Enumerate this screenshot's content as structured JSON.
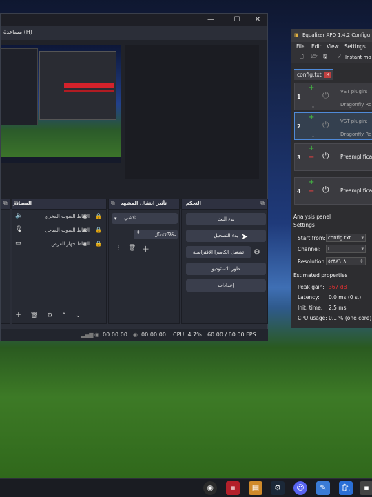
{
  "obs": {
    "help_menu": "مساعدة (H)",
    "window_controls": {
      "minimize": "—",
      "maximize": "☐",
      "close": "✕"
    },
    "sources": {
      "title": "المصادر",
      "items": [
        {
          "label": "التقاط الصوت المخرج",
          "icon": "speaker-icon"
        },
        {
          "label": "التقاط الصوت المدخل",
          "icon": "microphone-icon"
        },
        {
          "label": "التقاط جهاز العرض",
          "icon": "monitor-icon"
        }
      ]
    },
    "transitions": {
      "title": "تأثير انتقال المشهد",
      "selected": "تلاشي",
      "duration_label": "مدة الانتقال",
      "duration_value": "٣٠٠ ms"
    },
    "controls": {
      "title": "التحكم",
      "buttons": [
        "بدء البث",
        "بدء التسجيل",
        "تشغيل الكاميرا الافتراضية",
        "طور الاستوديو",
        "إعدادات"
      ]
    },
    "status": {
      "stream_time": "00:00:00",
      "rec_time": "00:00:00",
      "cpu": "CPU: 4.7%",
      "fps": "60.00 / 60.00 FPS"
    }
  },
  "eq": {
    "title": "Equalizer APO 1.4.2 Configu",
    "menu": [
      "File",
      "Edit",
      "View",
      "Settings"
    ],
    "toolbar_option": "Instant mo",
    "tab": "config.txt",
    "rows": [
      {
        "num": "1",
        "type": "vst",
        "label": "VST plugin:",
        "plugin": "Dragonfly Ro"
      },
      {
        "num": "2",
        "type": "vst",
        "label": "VST plugin:",
        "plugin": "Dragonfly Ro"
      },
      {
        "num": "3",
        "type": "pre",
        "label": "Preamplificat"
      },
      {
        "num": "4",
        "type": "pre",
        "label": "Preamplificat"
      }
    ],
    "analysis": {
      "panel_title": "Analysis panel",
      "settings_title": "Settings",
      "start_from_label": "Start from:",
      "start_from_value": "config.txt",
      "channel_label": "Channel:",
      "channel_value": "L",
      "resolution_label": "Resolution:",
      "resolution_value": "٥٢٣٨٦٠٨",
      "estimated_title": "Estimated properties",
      "peak_gain_label": "Peak gain:",
      "peak_gain_value": "367 dB",
      "peak_gain_color": "#e03030",
      "latency_label": "Latency:",
      "latency_value": "0.0 ms (0 s.)",
      "init_time_label": "Init. time:",
      "init_time_value": "2.5 ms",
      "cpu_usage_label": "CPU usage:",
      "cpu_usage_value": "0.1 % (one core)"
    }
  },
  "taskbar": {
    "icons": [
      "obs-icon",
      "game-icon",
      "files-icon",
      "steam-icon",
      "discord-icon",
      "notepad-icon",
      "store-icon"
    ]
  }
}
